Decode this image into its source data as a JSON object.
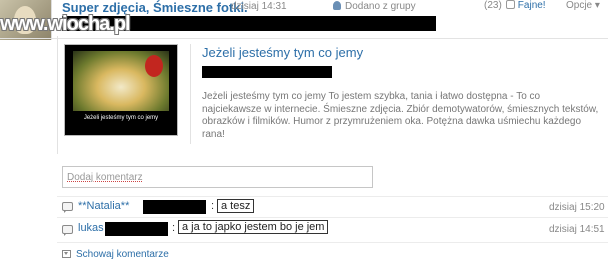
{
  "header": {
    "title": "Super zdjęcia, Śmieszne fotki.",
    "time": "dzisiaj 14:31",
    "added_label": "Dodano z grupy",
    "likes_count": "(23)",
    "likes_label": "Fajne!",
    "options_label": "Opcje ▾"
  },
  "watermark": "www.wiocha.pl",
  "link_card": {
    "title": "Jeżeli jesteśmy tym co jemy",
    "description": "Jeżeli jesteśmy tym co jemy To jestem szybka, tania i łatwo dostępna - To co najciekawsze w internecie. Śmieszne zdjęcia. Zbiór demotywatorów, śmiesznych tekstów, obrazków i filmików. Humor z przymrużeniem oka. Potężna dawka uśmiechu każdego rana!",
    "thumbnail_caption": "Jeżeli jesteśmy tym co jemy"
  },
  "comment_input": {
    "placeholder": "Dodaj komentarz"
  },
  "comments": [
    {
      "author": "**Natalia**",
      "text": "a tesz",
      "time": "dzisiaj 15:20"
    },
    {
      "author": "lukas",
      "text": "a ja to japko jestem bo je jem",
      "time": "dzisiaj 14:51"
    }
  ],
  "show_comments_label": "Schowaj komentarze",
  "colors": {
    "link": "#2d6fa8",
    "muted": "#888888",
    "redaction": "#000000"
  }
}
